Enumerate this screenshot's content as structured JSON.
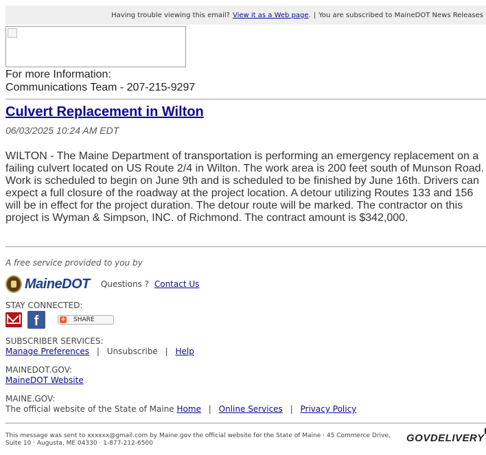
{
  "topbar": {
    "trouble_text": "Having trouble viewing this email?",
    "web_page_link": "View it as a Web page",
    "period": ".",
    "separator": "|",
    "subscribed_text": "You are subscribed to MaineDOT News Releases"
  },
  "contact": {
    "line1": "For more Information:",
    "line2": "Communications Team - 207-215-9297"
  },
  "article": {
    "title": "Culvert Replacement in Wilton",
    "date": "06/03/2025 10:24 AM EDT",
    "body": "WILTON - The Maine Department of transportation is performing an emergency replacement on a failing culvert located on US Route 2/4 in Wilton. The work area is 200 feet south of Munson Road. Work is scheduled to begin on June 9th and is scheduled to be finished by June 16th. Drivers can expect a full closure of the roadway at the project location. A detour utilizing Routes 133 and 156 will be in effect for the project duration. The detour route will be marked. The contractor on this project is Wyman & Simpson, INC. of Richmond. The contract amount is $342,000."
  },
  "footer": {
    "free_service": "A free service provided to you by",
    "logo_text": "MaineDOT",
    "questions_text": "Questions ?",
    "contact_link": "Contact Us",
    "stay_connected": "STAY CONNECTED:",
    "share_label": "SHARE",
    "share_plus": "+",
    "subscriber_services": "SUBSCRIBER SERVICES:",
    "manage_preferences": "Manage Preferences",
    "unsubscribe": "Unsubscribe",
    "help": "Help",
    "pipe": "|",
    "mainedot_gov_label": "MAINEDOT.GOV:",
    "mainedot_website": "MaineDOT Website",
    "maine_gov_label": "MAINE.GOV:",
    "official_site_text": "The official website of the State of Maine",
    "home_link": "Home",
    "online_services_link": "Online Services",
    "privacy_policy_link": "Privacy Policy",
    "message_sent": "This message was sent to xxxxxx@gmail.com by Maine.gov the official website for the State of Maine · 45 Commerce Drive, Suite 10 · Augusta, ME 04330 · 1-877-212-6500",
    "govdelivery": "GOVDELIVERY"
  },
  "icons": {
    "email": "email-icon",
    "facebook": "facebook-icon",
    "share": "share-icon",
    "seal": "maine-seal-icon",
    "broken_image": "broken-image-icon"
  },
  "colors": {
    "link": "#0b0b8f",
    "topbar_bg": "#efefef",
    "facebook": "#3b5998",
    "email_red": "#b11717",
    "logo_blue": "#1d3f8c"
  }
}
